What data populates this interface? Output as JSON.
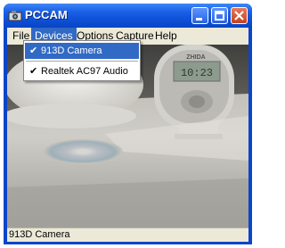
{
  "window": {
    "title": "PCCAM"
  },
  "menubar": {
    "items": [
      "File",
      "Devices",
      "Options",
      "Capture",
      "Help"
    ]
  },
  "devices_menu": {
    "items": [
      {
        "label": "913D Camera",
        "checked": true,
        "check": "✔"
      },
      {
        "label": "Realtek AC97 Audio",
        "checked": true,
        "check": "✔"
      }
    ]
  },
  "video": {
    "clock_brand": "ZHIDA",
    "clock_display": "10:23"
  },
  "statusbar": {
    "text": "913D Camera"
  },
  "colors": {
    "title_bar": "#0b45c8",
    "menu_highlight": "#316ac5",
    "menu_bg": "#ece9d8"
  }
}
